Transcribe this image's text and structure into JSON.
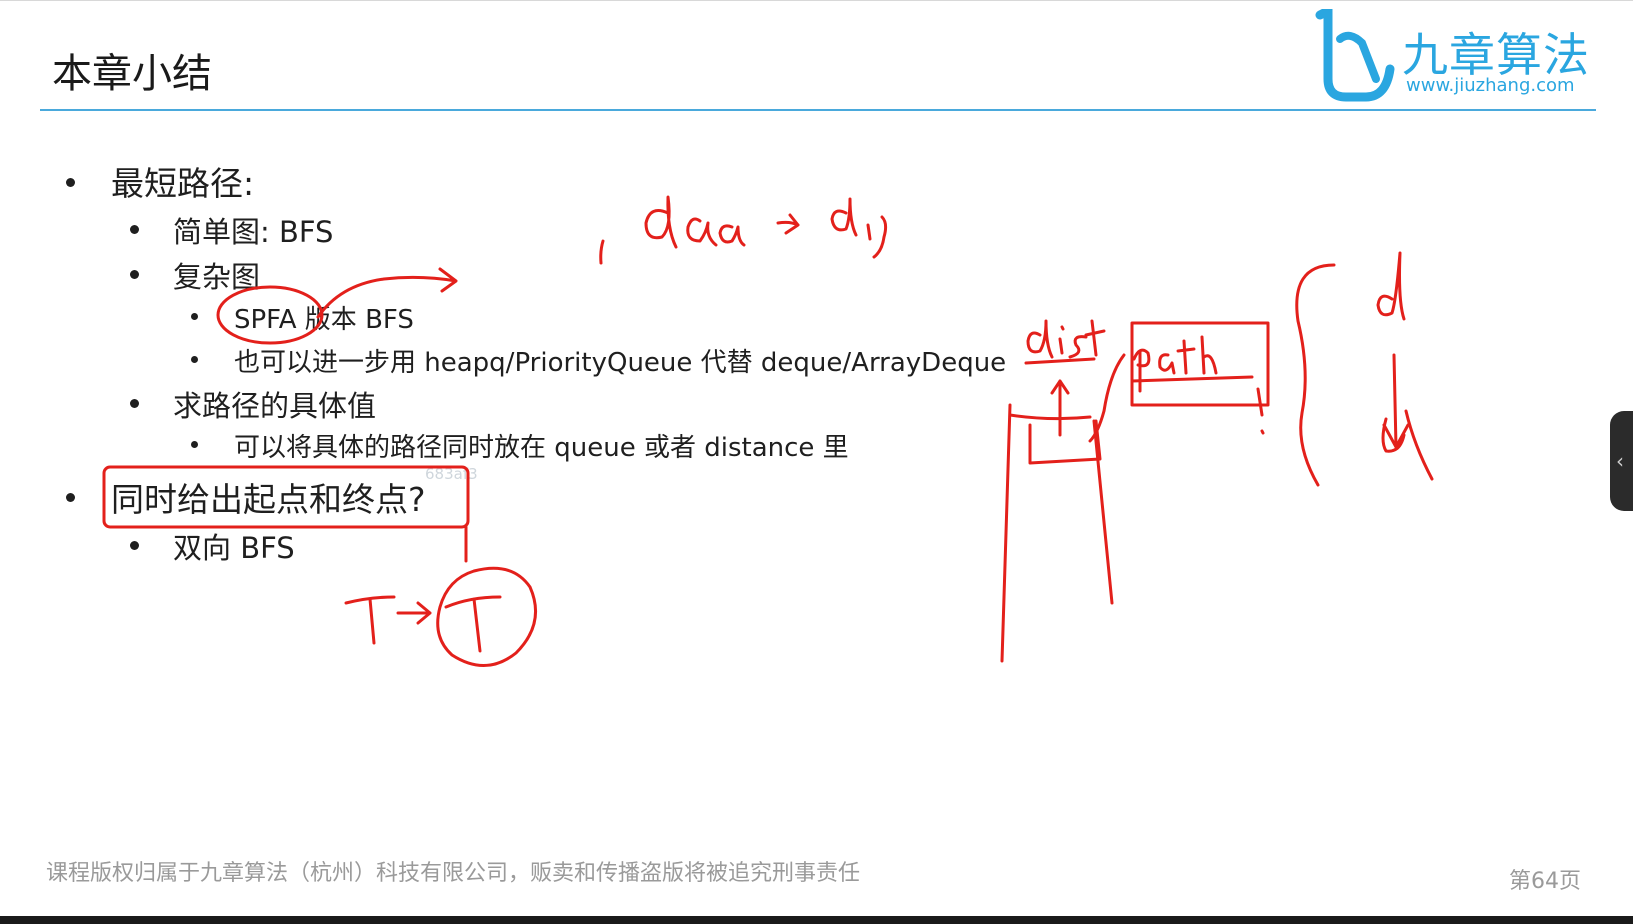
{
  "slide": {
    "title": "本章小结",
    "logo": {
      "name": "九章算法",
      "url": "www.jiuzhang.com",
      "icon": "jiuzhang-logo-icon",
      "color": "#2aa6e0"
    },
    "bullets": {
      "shortest_path": "最短路径:",
      "simple_graph": "简单图: BFS",
      "complex_graph": "复杂图",
      "spfa": "SPFA 版本 BFS",
      "heapq": "也可以进一步用 heapq/PriorityQueue 代替 deque/ArrayDeque",
      "path_value": "求路径的具体值",
      "path_in_queue": "可以将具体的路径同时放在 queue 或者 distance 里",
      "start_end": "同时给出起点和终点?",
      "bidirectional": "双向 BFS"
    },
    "watermark": "683af3",
    "footer": "课程版权归属于九章算法（杭州）科技有限公司，贩卖和传播盗版将被追究刑事责任",
    "page_number": "第64页"
  },
  "annotations": {
    "ink_color": "#e3201b",
    "notes": [
      "dist",
      "path"
    ]
  },
  "side_tab": {
    "icon": "chevron-left-icon",
    "glyph": "‹"
  }
}
